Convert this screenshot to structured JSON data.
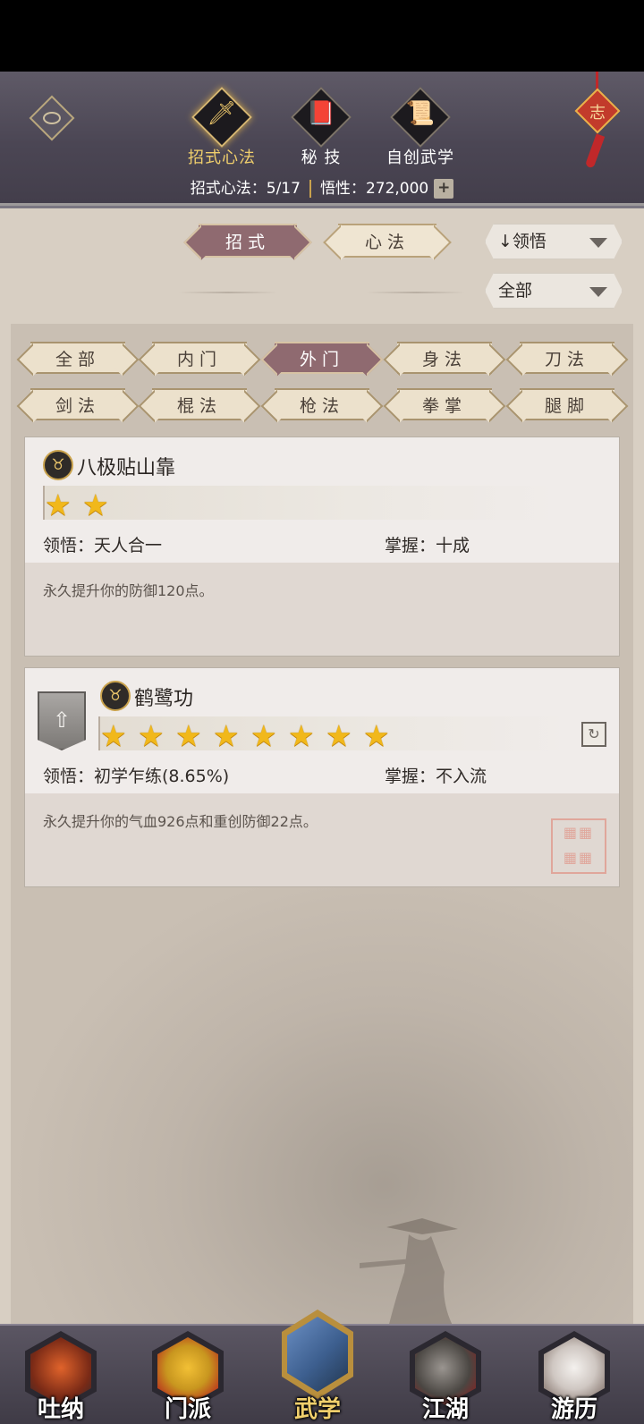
{
  "header": {
    "tabs": [
      {
        "label": "招式心法",
        "icon": "sword-icon",
        "active": true
      },
      {
        "label": "秘 技",
        "icon": "book-icon",
        "active": false
      },
      {
        "label": "自创武学",
        "icon": "scroll-icon",
        "active": false
      }
    ],
    "knot_char": "志",
    "stats": {
      "skills_label": "招式心法：",
      "skills_value": "5/17",
      "insight_label": "悟性：",
      "insight_value": "272,000",
      "plus": "+"
    }
  },
  "filters": {
    "type_tabs": [
      {
        "label": "招式",
        "active": true
      },
      {
        "label": "心法",
        "active": false
      }
    ],
    "sort_dropdown": "↓领悟",
    "scope_dropdown": "全部"
  },
  "categories": [
    {
      "label": "全部",
      "active": false
    },
    {
      "label": "内门",
      "active": false
    },
    {
      "label": "外门",
      "active": true
    },
    {
      "label": "身法",
      "active": false
    },
    {
      "label": "刀法",
      "active": false
    },
    {
      "label": "剑法",
      "active": false
    },
    {
      "label": "棍法",
      "active": false
    },
    {
      "label": "枪法",
      "active": false
    },
    {
      "label": "拳掌",
      "active": false
    },
    {
      "label": "腿脚",
      "active": false
    }
  ],
  "skills": [
    {
      "name": "八极贴山靠",
      "stars": 2,
      "insight_label": "领悟：",
      "insight_value": "天人合一",
      "mastery_label": "掌握：",
      "mastery_value": "十成",
      "description": "永久提升你的防御120点。"
    },
    {
      "name": "鹤鹭功",
      "stars": 8,
      "insight_label": "领悟：",
      "insight_value": "初学乍练(8.65%)",
      "mastery_label": "掌握：",
      "mastery_value": "不入流",
      "description": "永久提升你的气血926点和重创防御22点。",
      "has_upgrade": true
    }
  ],
  "nav": [
    {
      "label": "吐纳",
      "active": false,
      "color": "#7a2a16"
    },
    {
      "label": "门派",
      "active": false,
      "color": "#c8961f"
    },
    {
      "label": "武学",
      "active": true,
      "color": "#3d5f8f"
    },
    {
      "label": "江湖",
      "active": false,
      "color": "#8a2020"
    },
    {
      "label": "游历",
      "active": false,
      "color": "#7b6a62"
    }
  ]
}
